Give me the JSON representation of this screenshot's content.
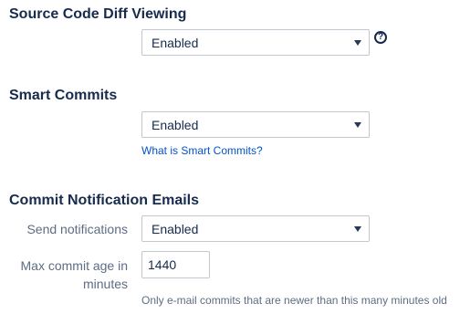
{
  "source_code_diff": {
    "heading": "Source Code Diff Viewing",
    "select_value": "Enabled",
    "help_icon": "question-circle-icon",
    "help_glyph": "?"
  },
  "smart_commits": {
    "heading": "Smart Commits",
    "select_value": "Enabled",
    "link_text": "What is Smart Commits?"
  },
  "commit_notifications": {
    "heading": "Commit Notification Emails",
    "send_label": "Send notifications",
    "send_value": "Enabled",
    "max_age_label_line1": "Max commit age in",
    "max_age_label_line2": "minutes",
    "max_age_value": "1440",
    "max_age_description": "Only e-mail commits that are newer than this many minutes old"
  },
  "colors": {
    "text": "#172b4d",
    "link": "#0052cc",
    "muted": "#5e6c84",
    "border": "#c1c7d0"
  }
}
